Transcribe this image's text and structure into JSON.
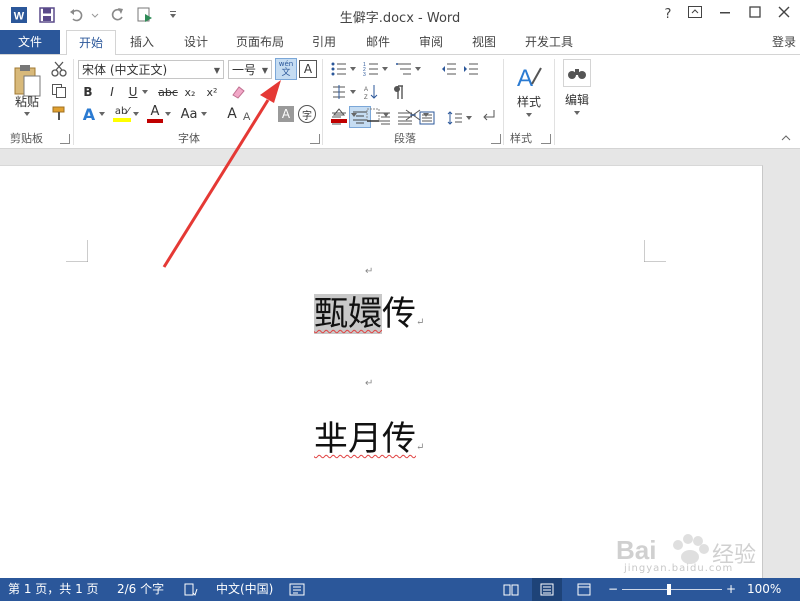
{
  "app": {
    "title": "生僻字.docx - Word",
    "word_logo_letter": "W",
    "login_label": "登录",
    "window_controls": [
      "?",
      "⧉",
      "—",
      "☐",
      "✕"
    ]
  },
  "quick_access": {
    "icons": [
      "word-logo-icon",
      "save-icon",
      "undo-icon",
      "redo-icon",
      "print-preview-icon",
      "customize-qat-icon"
    ]
  },
  "tabs": [
    {
      "label": "文件"
    },
    {
      "label": "开始"
    },
    {
      "label": "插入"
    },
    {
      "label": "设计"
    },
    {
      "label": "页面布局"
    },
    {
      "label": "引用"
    },
    {
      "label": "邮件"
    },
    {
      "label": "审阅"
    },
    {
      "label": "视图"
    },
    {
      "label": "开发工具"
    }
  ],
  "ribbon": {
    "clipboard": {
      "paste_label": "粘贴",
      "group_label": "剪贴板"
    },
    "font": {
      "font_name": "宋体 (中文正文)",
      "font_size": "一号",
      "phonetic_top": "wén",
      "phonetic_bottom": "文",
      "bold": "B",
      "italic": "I",
      "underline": "U",
      "strike": "abc",
      "subscript": "x₂",
      "superscript": "x²",
      "text_effects": "A",
      "highlight": "ab⁄",
      "font_color": "A",
      "change_case": "Aa",
      "grow_font": "A",
      "shading_char": "A",
      "enclose_char": "字",
      "char_border": "A",
      "group_label": "字体"
    },
    "paragraph": {
      "group_label": "段落"
    },
    "styles": {
      "label": "样式",
      "group_label": "样式"
    },
    "editing": {
      "label": "编辑"
    }
  },
  "document": {
    "line1_highlighted": "甄嬛",
    "line1_rest": "传",
    "line2": "芈月传",
    "para_mark": "↵"
  },
  "status": {
    "page": "第 1 页，共 1 页",
    "words": "2/6 个字",
    "language": "中文(中国)",
    "zoom_minus": "−",
    "zoom_plus": "+",
    "zoom": "100%",
    "zoom_level_percent": 100
  },
  "watermark": {
    "brand": "Bai",
    "brand_cn": "经验",
    "url": "jingyan.baidu.com"
  },
  "colors": {
    "accent": "#2b579a",
    "highlight": "#ffff00",
    "font_color": "#c00000",
    "arrow": "#e53935"
  }
}
